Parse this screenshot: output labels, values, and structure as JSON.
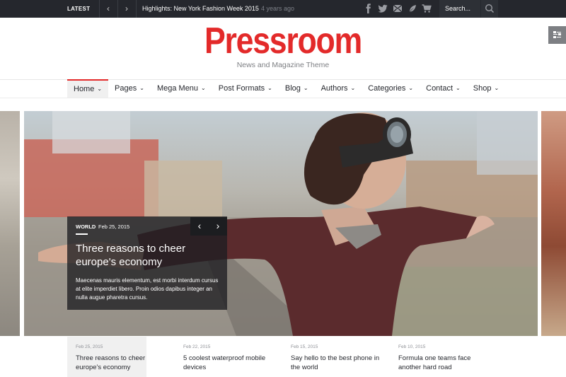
{
  "topbar": {
    "latest_label": "LATEST",
    "prev_arrow": "‹",
    "next_arrow": "›",
    "news_label": "Highlights: New York Fashion Week 2015",
    "news_ago": "4 years ago",
    "search_placeholder": "Search..."
  },
  "header": {
    "logo": "Pressroom",
    "tagline": "News and Magazine Theme"
  },
  "menu": {
    "items": [
      {
        "label": "Home"
      },
      {
        "label": "Pages"
      },
      {
        "label": "Mega Menu"
      },
      {
        "label": "Post Formats"
      },
      {
        "label": "Blog"
      },
      {
        "label": "Authors"
      },
      {
        "label": "Categories"
      },
      {
        "label": "Contact"
      },
      {
        "label": "Shop"
      }
    ]
  },
  "slider": {
    "category": "WORLD",
    "date": "Feb 25, 2015",
    "title": "Three reasons to cheer europe's economy",
    "excerpt": "Maecenas mauris elementum, est morbi interdum cursus at elite imperdiet libero. Proin odios dapibus integer an nulla augue pharetra cursus.",
    "prev": "‹",
    "next": "›"
  },
  "bottom_posts": [
    {
      "date": "Feb 25, 2015",
      "title": "Three reasons to cheer europe's economy"
    },
    {
      "date": "Feb 22, 2015",
      "title": "5 coolest waterproof mobile devices"
    },
    {
      "date": "Feb 15, 2015",
      "title": "Say hello to the best phone in the world"
    },
    {
      "date": "Feb 10, 2015",
      "title": "Formula one teams face another hard road"
    }
  ],
  "colors": {
    "accent": "#e32a2a",
    "topbar_bg": "#25272d",
    "text_dark": "#25272d",
    "text_muted": "#7d7f83"
  }
}
